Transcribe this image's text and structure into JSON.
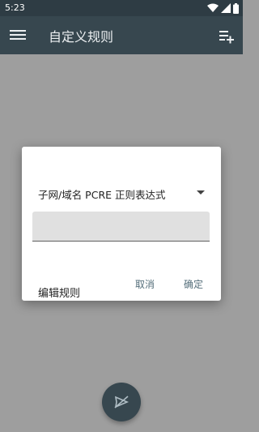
{
  "status_bar": {
    "time": "5:23",
    "icons": [
      "wifi-icon",
      "signal-icon",
      "battery-icon"
    ]
  },
  "app_bar": {
    "title": "自定义规则",
    "menu_icon": "menu-icon",
    "action_icon": "playlist-add-icon"
  },
  "dialog": {
    "title": "编辑规则",
    "rule_type": "子网/域名 PCRE 正则表达式",
    "input_value": "",
    "cancel_label": "取消",
    "ok_label": "确定"
  },
  "fab": {
    "icon": "send-off-icon"
  },
  "colors": {
    "app_bar": "#37474f",
    "status_bar": "#2e3c44",
    "accent": "#546e7a",
    "scrim": "#9e9e9e"
  }
}
